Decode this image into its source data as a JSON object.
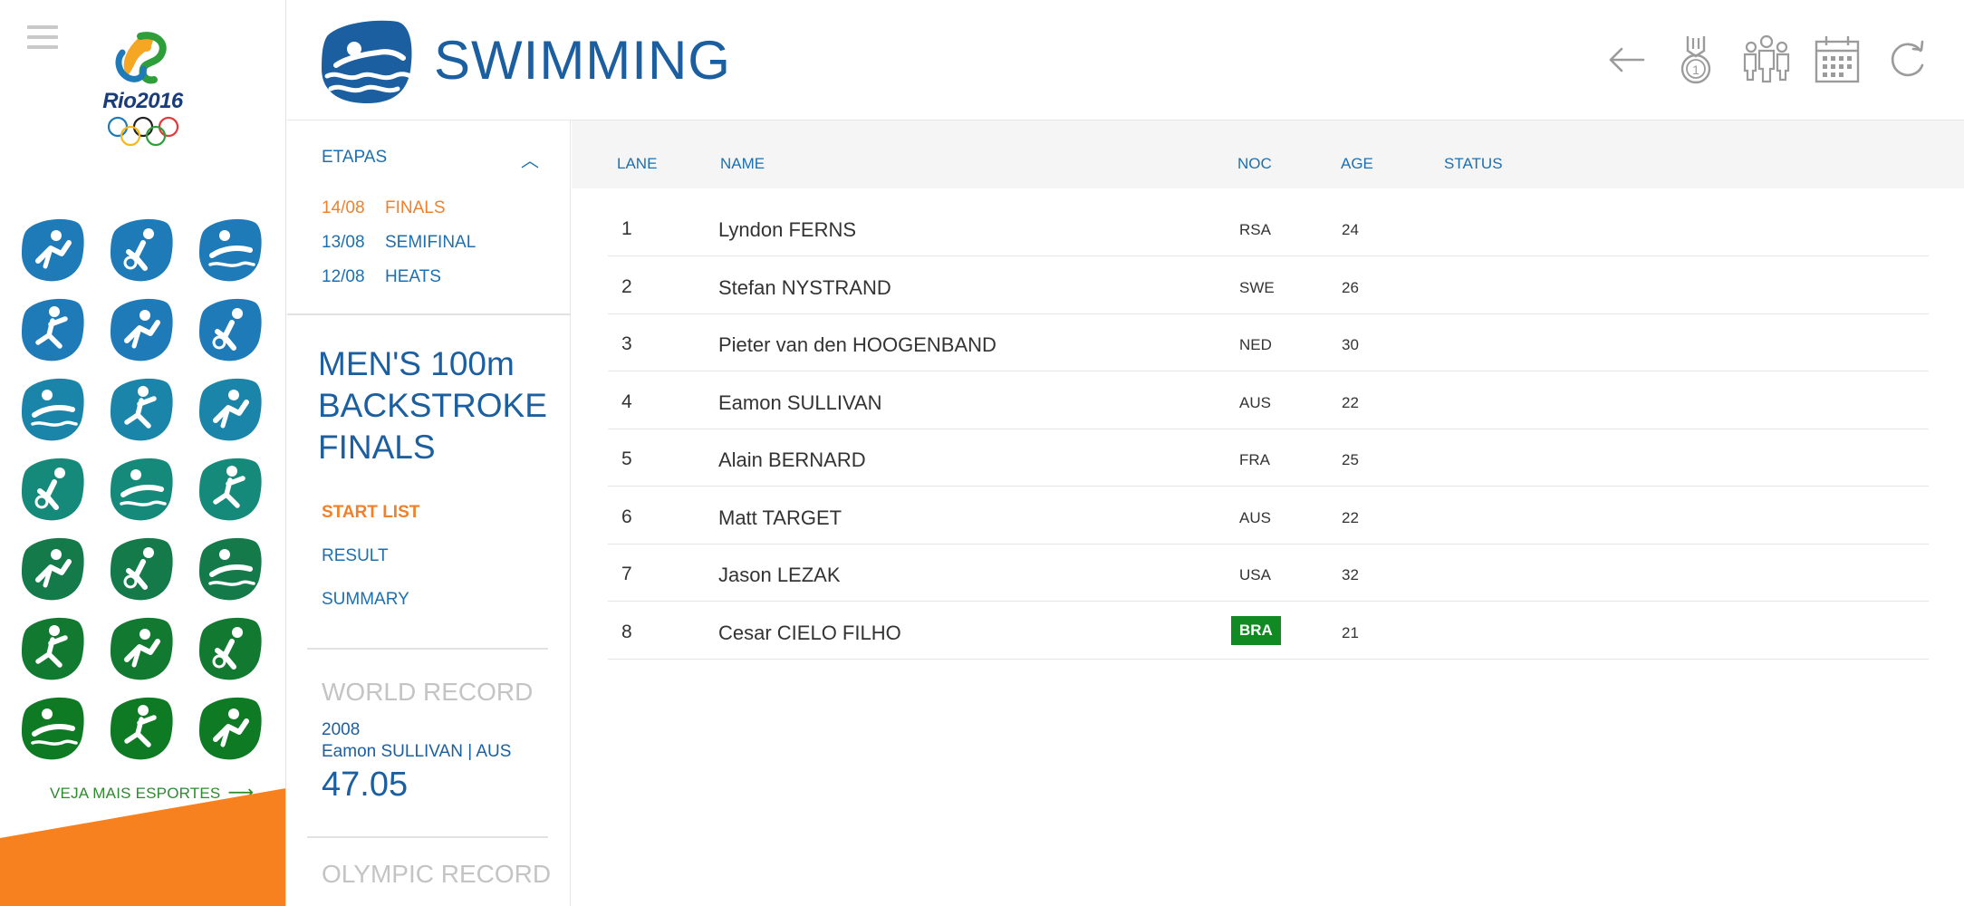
{
  "sidebar": {
    "logo_text": "Rio2016",
    "more_sports_label": "VEJA MAIS ESPORTES",
    "sports": [
      {
        "name": "athletics-icon",
        "color": "#1f7ab8"
      },
      {
        "name": "badminton-icon",
        "color": "#1f7ab8"
      },
      {
        "name": "beach-volleyball-icon",
        "color": "#1f7ab8"
      },
      {
        "name": "cycling-bmx-icon",
        "color": "#1f7ab8"
      },
      {
        "name": "cycling-mountain-bike-icon",
        "color": "#1f7ab8"
      },
      {
        "name": "cycling-road-icon",
        "color": "#1f7ab8"
      },
      {
        "name": "swimming-icon",
        "color": "#1a85a8"
      },
      {
        "name": "water-polo-icon",
        "color": "#1a85a8"
      },
      {
        "name": "diving-icon",
        "color": "#1a85a8"
      },
      {
        "name": "rhythmic-gymnastics-icon",
        "color": "#158a7a"
      },
      {
        "name": "artistic-gymnastics-icon",
        "color": "#158a7a"
      },
      {
        "name": "golf-icon",
        "color": "#158a7a"
      },
      {
        "name": "hockey-icon",
        "color": "#157a4a"
      },
      {
        "name": "handball-icon",
        "color": "#157a4a"
      },
      {
        "name": "wrestling-icon",
        "color": "#157a4a"
      },
      {
        "name": "rowing-icon",
        "color": "#127a30"
      },
      {
        "name": "rugby-icon",
        "color": "#127a30"
      },
      {
        "name": "taekwondo-icon",
        "color": "#127a30"
      },
      {
        "name": "fencing-icon",
        "color": "#0f7a24"
      },
      {
        "name": "triathlon-icon",
        "color": "#0f7a24"
      },
      {
        "name": "sailing-icon",
        "color": "#0f7a24"
      }
    ]
  },
  "header": {
    "title": "SWIMMING",
    "buttons": [
      "back-arrow-icon",
      "medal-icon",
      "athletes-icon",
      "calendar-icon",
      "refresh-icon"
    ]
  },
  "stages": {
    "heading": "ETAPAS",
    "items": [
      {
        "date": "14/08",
        "label": "FINALS",
        "active": true
      },
      {
        "date": "13/08",
        "label": "SEMIFINAL",
        "active": false
      },
      {
        "date": "12/08",
        "label": "HEATS",
        "active": false
      }
    ]
  },
  "event": {
    "title_line1": "MEN'S 100m",
    "title_line2": "BACKSTROKE",
    "title_line3": "FINALS",
    "links": [
      {
        "label": "START LIST",
        "active": true
      },
      {
        "label": "RESULT",
        "active": false
      },
      {
        "label": "SUMMARY",
        "active": false
      }
    ]
  },
  "world_record": {
    "title": "WORLD RECORD",
    "year": "2008",
    "holder": "Eamon SULLIVAN | AUS",
    "time": "47.05"
  },
  "olympic_record": {
    "title": "OLYMPIC RECORD"
  },
  "table": {
    "headers": {
      "lane": "LANE",
      "name": "NAME",
      "noc": "NOC",
      "age": "AGE",
      "status": "STATUS"
    },
    "rows": [
      {
        "lane": "1",
        "name": "Lyndon FERNS",
        "noc": "RSA",
        "age": "24",
        "highlight": false
      },
      {
        "lane": "2",
        "name": "Stefan NYSTRAND",
        "noc": "SWE",
        "age": "26",
        "highlight": false
      },
      {
        "lane": "3",
        "name": "Pieter van den HOOGENBAND",
        "noc": "NED",
        "age": "30",
        "highlight": false
      },
      {
        "lane": "4",
        "name": "Eamon SULLIVAN",
        "noc": "AUS",
        "age": "22",
        "highlight": false
      },
      {
        "lane": "5",
        "name": "Alain BERNARD",
        "noc": "FRA",
        "age": "25",
        "highlight": false
      },
      {
        "lane": "6",
        "name": "Matt TARGET",
        "noc": "AUS",
        "age": "22",
        "highlight": false
      },
      {
        "lane": "7",
        "name": "Jason LEZAK",
        "noc": "USA",
        "age": "32",
        "highlight": false
      },
      {
        "lane": "8",
        "name": "Cesar CIELO FILHO",
        "noc": "BRA",
        "age": "21",
        "highlight": true
      }
    ]
  },
  "colors": {
    "brand_blue": "#1c5fa0",
    "link_blue": "#1c6fb0",
    "active_orange": "#f0812a",
    "highlight_green": "#118a23"
  }
}
